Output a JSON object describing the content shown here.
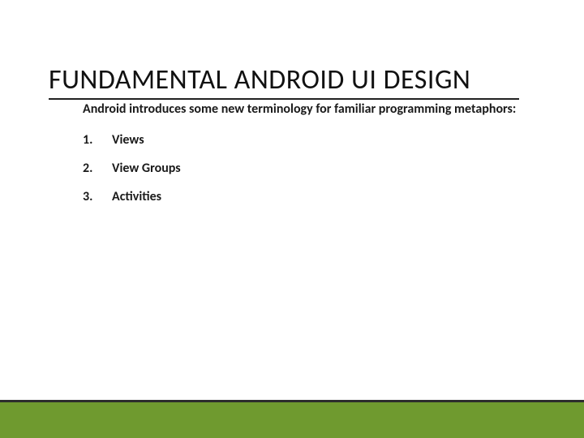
{
  "slide": {
    "title": "FUNDAMENTAL ANDROID UI DESIGN",
    "intro": "Android introduces some new terminology for familiar programming metaphors:",
    "items": [
      {
        "num": "1.",
        "label": "Views"
      },
      {
        "num": "2.",
        "label": "View Groups"
      },
      {
        "num": "3.",
        "label": "Activities"
      }
    ]
  }
}
